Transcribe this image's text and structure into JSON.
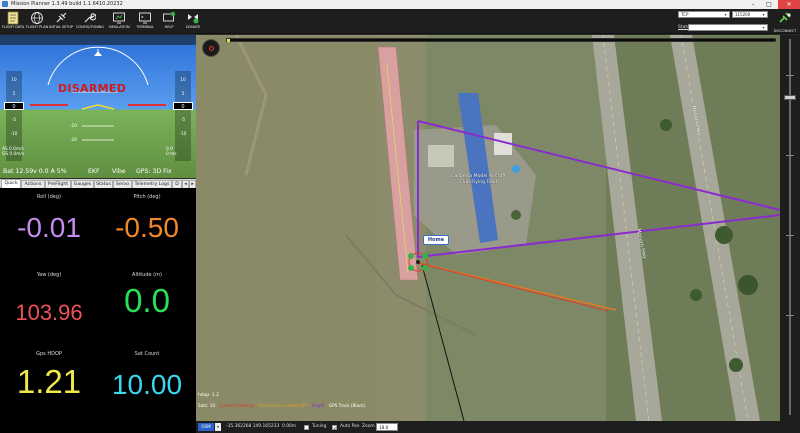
{
  "window": {
    "title": "Mission Planner 1.3.49 build 1.1.6410.20232",
    "min_glyph": "–",
    "max_glyph": "□",
    "close_glyph": "✕"
  },
  "toolbar": {
    "buttons": [
      {
        "label": "FLIGHT DATA",
        "icon": "flight-data-icon"
      },
      {
        "label": "FLIGHT PLAN",
        "icon": "globe-icon"
      },
      {
        "label": "INITIAL SETUP",
        "icon": "plug-icon"
      },
      {
        "label": "CONFIG/TUNING",
        "icon": "wrench-icon"
      },
      {
        "label": "SIMULATION",
        "icon": "monitor-icon"
      },
      {
        "label": "TERMINAL",
        "icon": "terminal-icon"
      },
      {
        "label": "HELP",
        "icon": "help-icon"
      },
      {
        "label": "DONATE",
        "icon": "donate-icon"
      }
    ],
    "port_value": "TCP",
    "baud_value": "115200",
    "stats_label": "Stats...",
    "disconnect_label": "DISCONNECT",
    "dropdown_glyph": "▾"
  },
  "hud": {
    "status": "DISARMED",
    "speed_ticks": [
      "10",
      "5",
      "0",
      "-5",
      "-10"
    ],
    "speed_value": "0",
    "alt_ticks": [
      "10",
      "5",
      "0",
      "-5",
      "-10"
    ],
    "alt_value": "0",
    "pitch_ticks": [
      "10",
      "-10",
      "-20"
    ],
    "left_info": [
      "AS 0.0m/s",
      "GS 0.0m/s"
    ],
    "right_info": [
      "0.0",
      "0 ms"
    ],
    "battery": "Bat 12.59v 0.0 A 5%",
    "ekf": "EKF",
    "vibe": "Vibe",
    "gps": "GPS: 3D Fix"
  },
  "tabs": [
    "Quick",
    "Actions",
    "PreFlight",
    "Gauges",
    "Status",
    "Servo",
    "Telemetry Logs",
    "D"
  ],
  "tab_nav_glyphs": [
    "◂",
    "▸"
  ],
  "quick": [
    {
      "label": "Roll (deg)",
      "value": "-0.01",
      "color": "#c58cf0"
    },
    {
      "label": "Pitch (deg)",
      "value": "-0.50",
      "color": "#f08a28"
    },
    {
      "label": "Yaw (deg)",
      "value": "103.96",
      "color": "#f0505a"
    },
    {
      "label": "Altitude (m)",
      "value": "0.0",
      "color": "#28e05a"
    },
    {
      "label": "Gps HDOP",
      "value": "1.21",
      "color": "#f0e84a"
    },
    {
      "label": "Sat Count",
      "value": "10.00",
      "color": "#3ad8f0"
    }
  ],
  "map": {
    "home_label": "Home",
    "club_label": [
      "Canberra Model Aircraft",
      "Club Flying Field"
    ],
    "road_labels": [
      "Monaro Hwy",
      "Monaro Hwy"
    ],
    "hdop_text": "hdop: 1.2",
    "sats_text": "Sats: 10",
    "legend": [
      {
        "text": "Current Heading",
        "color": "#e03b2b"
      },
      {
        "text": "Direction to current WP",
        "color": "#e0a020"
      },
      {
        "text": "Target",
        "color": "#8a2bd0"
      },
      {
        "text": "GPS Track (Black)",
        "color": "#ffffff"
      }
    ]
  },
  "statusbar": {
    "map_type": "OSM",
    "coords": "-35.362268 149.165233",
    "distance": "0.00m",
    "tuning_label": "Tuning",
    "autopan_label": "Auto Pan",
    "zoom_label": "Zoom",
    "zoom_value": "18.0"
  }
}
